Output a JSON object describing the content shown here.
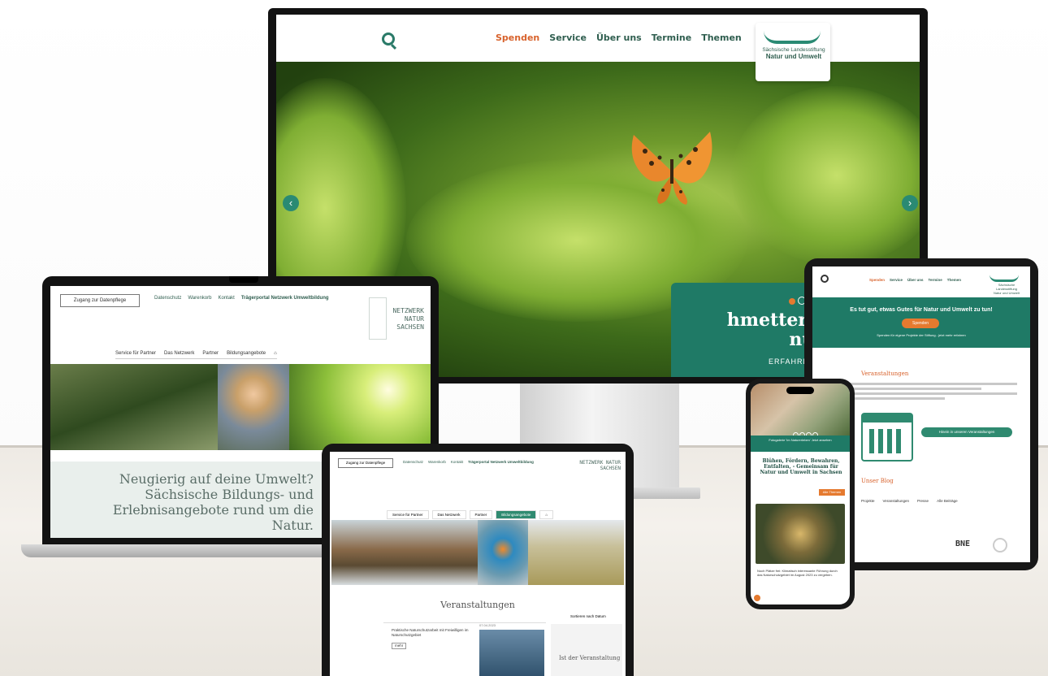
{
  "scene": {
    "colors": {
      "brand_green": "#1f7a66",
      "accent_orange": "#e57a2f",
      "text_dark_green": "#2f5e4f"
    }
  },
  "monitor": {
    "nav": {
      "items": [
        "Themen",
        "Termine",
        "Über uns",
        "Service",
        "Spenden"
      ],
      "search_icon": "search-icon"
    },
    "logo": {
      "line1": "Sächsische Landesstiftung",
      "line2": "Natur und Umwelt"
    },
    "hero": {
      "headline_line1": "hmetterlinge",
      "headline_line2": "nützen",
      "sub": "ERFAHREN",
      "slide_prev": "‹",
      "slide_next": "›"
    }
  },
  "laptop": {
    "access_button": "Zugang zur Datenpflege",
    "top_links": [
      "Trägerportal Netzwerk Umweltbildung",
      "Kontakt",
      "Warenkorb",
      "Datenschutz"
    ],
    "logo_text": "NETZWERK NATUR SACHSEN",
    "menu": [
      "⌂",
      "Bildungsangebote",
      "Partner",
      "Das Netzwerk",
      "Service für Partner"
    ],
    "headline": "Neugierig auf deine Umwelt? Sächsische Bildungs- und Erlebnisangebote rund um die Natur."
  },
  "tablet_front": {
    "access_button": "Zugang zur Datenpflege",
    "top_links": [
      "Trägerportal Netzwerk Umweltbildung",
      "Kontakt",
      "Warenkorb",
      "Datenschutz"
    ],
    "logo_text": "NETZWERK NATUR SACHSEN",
    "menu": [
      "⌂",
      "Bildungsangebote",
      "Partner",
      "Das Netzwerk",
      "Service für Partner"
    ],
    "section_title": "Veranstaltungen",
    "sort_label": "Sortieren nach Datum",
    "card_date": "07.04.2023",
    "card_text": "Praktische Naturschutzarbeit mit Freiwilligen im Naturschutzgebiet",
    "card_more": "mehr",
    "sidebar_label": "Ist der Veranstaltung"
  },
  "tablet_right": {
    "nav": {
      "items": [
        "Themen",
        "Termine",
        "Über uns",
        "Service",
        "Spenden"
      ]
    },
    "logo": {
      "line1": "Sächsische Landesstiftung",
      "line2": "Natur und Umwelt"
    },
    "banner_headline": "Es tut gut, etwas Gutes für Natur und Umwelt zu tun!",
    "banner_button": "Spenden",
    "banner_sub": "Spenden für eigene Projekte der Stiftung - jetzt mehr erfahren",
    "events_heading": "Veranstaltungen",
    "cta": "Hinein in unseren Veranstaltungen",
    "blog_heading": "Unser Blog",
    "blog_tabs": [
      "Alle Beiträge",
      "Presse",
      "Veranstaltungen",
      "Projekte"
    ],
    "bne_label": "BNE"
  },
  "phone": {
    "green_caption": "Fotogalerie 'Im Naturerleben' Jetzt ansehen",
    "headline": "Blühen, Fördern, Bewahren, Entfalten, - Gemeinsam für Natur und Umwelt in Sachsen",
    "button": "Alle Themen",
    "text": "Noch Plätze frei: Klimatisch interessante Führung durch das Naturschutzgebiet im August 2023 zu vergeben."
  }
}
